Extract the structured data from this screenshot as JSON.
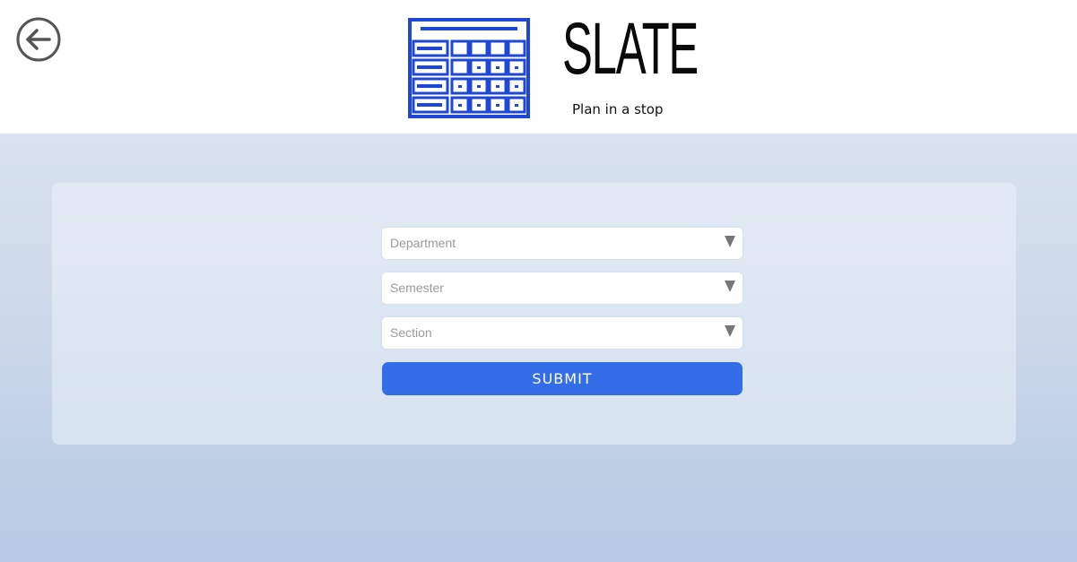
{
  "header": {
    "logo": {
      "title": "SLATE",
      "tagline": "Plan in a stop",
      "icon": "calendar-grid-icon",
      "brand_color": "#1f47d6"
    },
    "back_icon": "arrow-left-circle-icon"
  },
  "form": {
    "fields": [
      {
        "placeholder": "Department"
      },
      {
        "placeholder": "Semester"
      },
      {
        "placeholder": "Section"
      }
    ],
    "submit_label": "SUBMIT",
    "accent_color": "#346de8"
  }
}
